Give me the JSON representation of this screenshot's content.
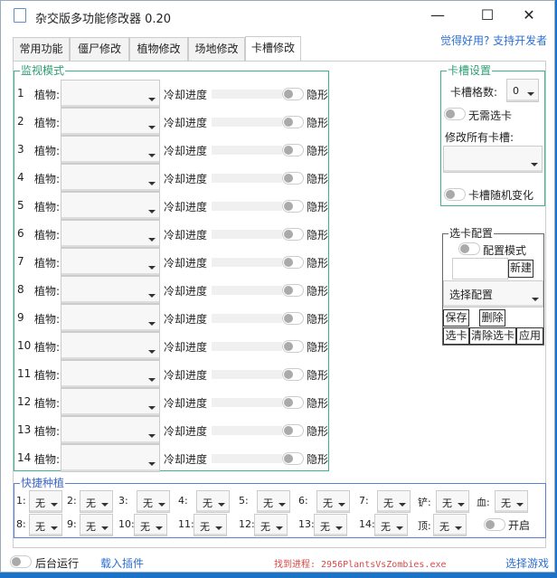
{
  "window": {
    "title": "杂交版多功能修改器  0.20",
    "minimize": "—",
    "maximize": "☐",
    "close": "✕"
  },
  "support_link": "觉得好用? 支持开发者",
  "tabs": [
    "常用功能",
    "僵尸修改",
    "植物修改",
    "场地修改",
    "卡槽修改"
  ],
  "active_tab": 4,
  "monitor": {
    "title": "监视模式",
    "plant_label": "植物:",
    "cooldown_label": "冷却进度",
    "invisible_label": "隐形",
    "rows": [
      "1",
      "2",
      "3",
      "4",
      "5",
      "6",
      "7",
      "8",
      "9",
      "10",
      "11",
      "12",
      "13",
      "14"
    ]
  },
  "card_settings": {
    "title": "卡槽设置",
    "slot_count_label": "卡槽格数:",
    "slot_count_value": "0",
    "no_select_label": "无需选卡",
    "modify_all_label": "修改所有卡槽:",
    "random_label": "卡槽随机变化"
  },
  "select_config": {
    "title": "选卡配置",
    "config_mode_label": "配置模式",
    "new_button": "新建",
    "select_placeholder": "选择配置",
    "save_button": "保存",
    "delete_button": "删除",
    "select_card_button": "选卡",
    "clear_button": "清除选卡",
    "apply_button": "应用"
  },
  "quick_plant": {
    "title": "快捷种植",
    "row1": [
      {
        "label": "1:",
        "value": "无"
      },
      {
        "label": "2:",
        "value": "无"
      },
      {
        "label": "3:",
        "value": "无"
      },
      {
        "label": "4:",
        "value": "无"
      },
      {
        "label": "5:",
        "value": "无"
      },
      {
        "label": "6:",
        "value": "无"
      },
      {
        "label": "7:",
        "value": "无"
      },
      {
        "label": "铲:",
        "value": "无"
      },
      {
        "label": "血:",
        "value": "无"
      }
    ],
    "row2": [
      {
        "label": "8:",
        "value": "无"
      },
      {
        "label": "9:",
        "value": "无"
      },
      {
        "label": "10:",
        "value": "无"
      },
      {
        "label": "11:",
        "value": "无"
      },
      {
        "label": "12:",
        "value": "无"
      },
      {
        "label": "13:",
        "value": "无"
      },
      {
        "label": "14:",
        "value": "无"
      },
      {
        "label": "顶:",
        "value": "无"
      }
    ],
    "enable_label": "开启"
  },
  "footer": {
    "background_label": "后台运行",
    "load_plugin": "载入插件",
    "process_status": "找到进程: 2956PlantsVsZombies.exe",
    "select_game": "选择游戏"
  }
}
